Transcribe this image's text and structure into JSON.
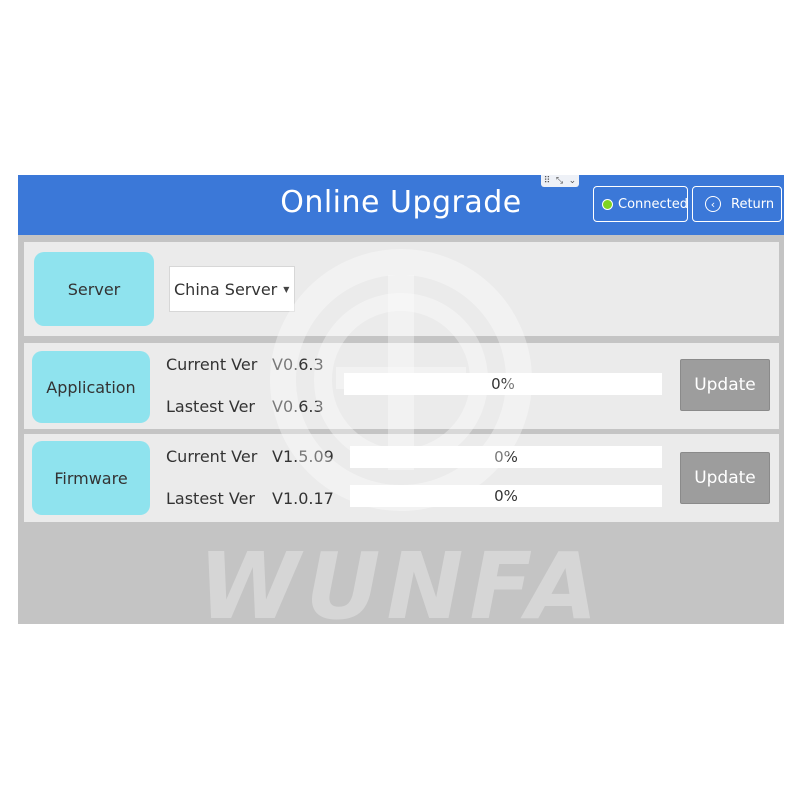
{
  "header": {
    "title": "Online Upgrade",
    "connected_label": "Connected",
    "return_label": "Return",
    "window_controls": [
      "⠿",
      "⤡",
      "⌄"
    ]
  },
  "server": {
    "label": "Server",
    "selected": "China Server"
  },
  "application": {
    "label": "Application",
    "current_label": "Current Ver",
    "current_value": "V0.6.3",
    "latest_label": "Lastest Ver",
    "latest_value": "V0.6.3",
    "progress_text": "0%",
    "progress": 0,
    "update_label": "Update"
  },
  "firmware": {
    "label": "Firmware",
    "current_label": "Current Ver",
    "current_value": "V1.5.09",
    "latest_label": "Lastest Ver",
    "latest_value": "V1.0.17",
    "current_progress_text": "0%",
    "current_progress": 0,
    "latest_progress_text": "0%",
    "latest_progress": 0,
    "update_label": "Update"
  },
  "watermark": {
    "text": "WUNFA"
  },
  "colors": {
    "header": "#3b78d8",
    "chip": "#8fe3ee",
    "status_connected": "#7ed321",
    "update_button": "#9d9d9d",
    "background": "#c4c4c4",
    "panel": "#ebebeb"
  }
}
